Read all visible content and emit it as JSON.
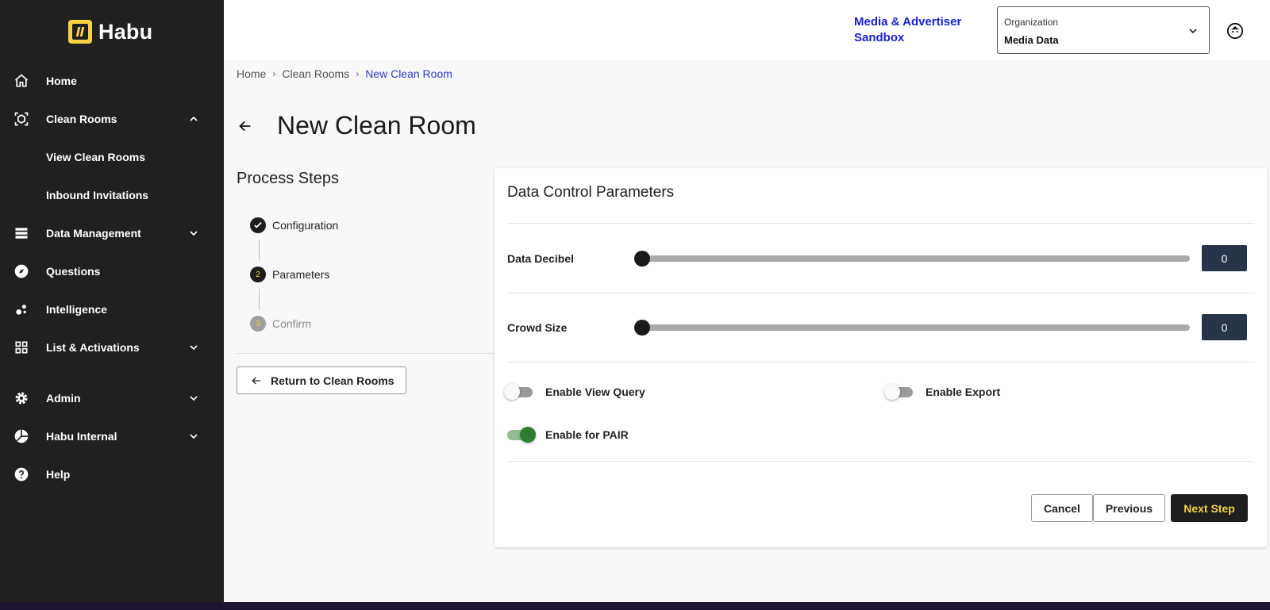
{
  "app": {
    "logo_text": "Habu"
  },
  "sidebar": {
    "items": [
      {
        "label": "Home",
        "icon": "home-icon"
      },
      {
        "label": "Clean Rooms",
        "icon": "clean-rooms-icon",
        "expanded": true
      },
      {
        "label": "View Clean Rooms"
      },
      {
        "label": "Inbound Invitations"
      },
      {
        "label": "Data Management",
        "icon": "database-icon",
        "expanded": false
      },
      {
        "label": "Questions",
        "icon": "compass-icon"
      },
      {
        "label": "Intelligence",
        "icon": "intelligence-icon"
      },
      {
        "label": "List & Activations",
        "icon": "grid-icon",
        "expanded": false
      },
      {
        "label": "Admin",
        "icon": "gear-icon",
        "expanded": false
      },
      {
        "label": "Habu Internal",
        "icon": "pie-icon",
        "expanded": false
      },
      {
        "label": "Help",
        "icon": "help-icon"
      }
    ]
  },
  "header": {
    "sandbox": "Media & Advertiser Sandbox",
    "org_label": "Organization",
    "org_value": "Media Data"
  },
  "breadcrumb": {
    "items": [
      "Home",
      "Clean Rooms",
      "New Clean Room"
    ],
    "separator": "›"
  },
  "page": {
    "title": "New Clean Room"
  },
  "steps": {
    "title": "Process Steps",
    "items": [
      {
        "number": "",
        "label": "Configuration",
        "state": "done"
      },
      {
        "number": "2",
        "label": "Parameters",
        "state": "active"
      },
      {
        "number": "3",
        "label": "Confirm",
        "state": "pending"
      }
    ],
    "return_label": "Return to Clean Rooms"
  },
  "card": {
    "title": "Data Control Parameters",
    "params": [
      {
        "label": "Data Decibel",
        "value": "0",
        "fraction": 0
      },
      {
        "label": "Crowd Size",
        "value": "0",
        "fraction": 0
      }
    ],
    "toggles": [
      {
        "label": "Enable View Query",
        "on": false
      },
      {
        "label": "Enable Export",
        "on": false
      },
      {
        "label": "Enable for PAIR",
        "on": true
      }
    ],
    "buttons": {
      "cancel": "Cancel",
      "previous": "Previous",
      "next": "Next Step"
    }
  },
  "colors": {
    "accent_yellow": "#f6d244",
    "sidebar_bg": "#202020",
    "link_blue": "#1a20d8",
    "toggle_on": "#2e7d32",
    "value_box": "#283447"
  }
}
